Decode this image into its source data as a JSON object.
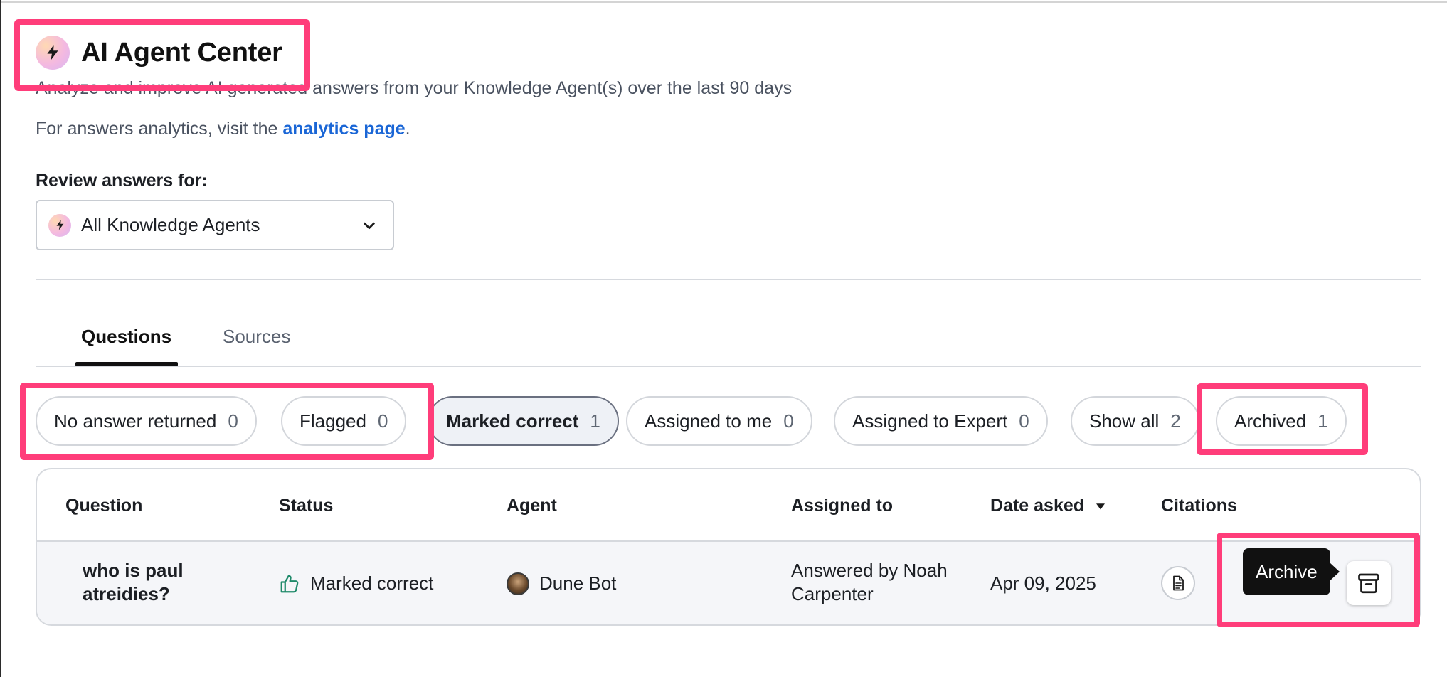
{
  "header": {
    "title": "AI Agent Center",
    "subtitle": "Analyze and improve AI generated answers from your Knowledge Agent(s) over the last 90 days",
    "analytics_prefix": "For answers analytics, visit the ",
    "analytics_link": "analytics page",
    "analytics_suffix": "."
  },
  "review": {
    "label": "Review answers for:",
    "selected": "All Knowledge Agents"
  },
  "tabs": [
    {
      "label": "Questions",
      "active": true
    },
    {
      "label": "Sources",
      "active": false
    }
  ],
  "filters": [
    {
      "label": "No answer returned",
      "count": "0"
    },
    {
      "label": "Flagged",
      "count": "0"
    },
    {
      "label": "Marked correct",
      "count": "1",
      "active": true
    },
    {
      "label": "Assigned to me",
      "count": "0"
    },
    {
      "label": "Assigned to Expert",
      "count": "0"
    },
    {
      "label": "Show all",
      "count": "2"
    },
    {
      "label": "Archived",
      "count": "1"
    }
  ],
  "table": {
    "columns": [
      "Question",
      "Status",
      "Agent",
      "Assigned to",
      "Date asked",
      "Citations"
    ],
    "rows": [
      {
        "question_line1": "who is paul",
        "question_line2": "atreidies?",
        "status": "Marked correct",
        "agent": "Dune Bot",
        "assigned_line1": "Answered by Noah",
        "assigned_line2": "Carpenter",
        "date": "Apr 09, 2025"
      }
    ]
  },
  "tooltip": "Archive",
  "icons": {
    "brand": "lightning-bolt-icon",
    "select": "chevron-down-icon",
    "sort": "caret-down-icon",
    "status": "thumbs-up-icon",
    "citation": "document-icon",
    "archive": "archive-box-icon"
  },
  "colors": {
    "link": "#1a66d6",
    "highlight": "#ff3d7a",
    "status_icon": "#1f8a6a"
  }
}
